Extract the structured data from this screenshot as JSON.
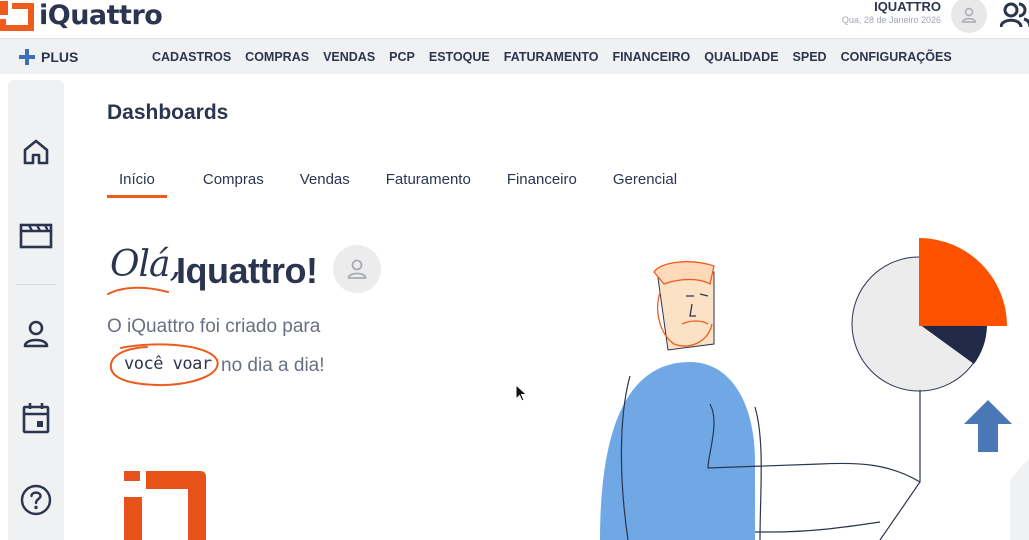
{
  "header": {
    "brand": "iQuattro",
    "user_name": "IQUATTRO",
    "date": "Qua, 28 de Janeiro 2026"
  },
  "nav": {
    "plus_label": "PLUS",
    "items": [
      "CADASTROS",
      "COMPRAS",
      "VENDAS",
      "PCP",
      "ESTOQUE",
      "FATURAMENTO",
      "FINANCEIRO",
      "QUALIDADE",
      "SPED",
      "CONFIGURAÇÕES"
    ]
  },
  "sidebar": {
    "icons": [
      "home-icon",
      "clapperboard-icon",
      "user-icon",
      "calendar-icon",
      "help-icon"
    ]
  },
  "main": {
    "title": "Dashboards",
    "tabs": [
      {
        "label": "Início",
        "active": true
      },
      {
        "label": "Compras",
        "active": false
      },
      {
        "label": "Vendas",
        "active": false
      },
      {
        "label": "Faturamento",
        "active": false
      },
      {
        "label": "Financeiro",
        "active": false
      },
      {
        "label": "Gerencial",
        "active": false
      }
    ],
    "greeting_hello": "Olá,",
    "greeting_name": "Iquattro!",
    "tagline_1": "O iQuattro foi criado para",
    "tagline_highlight": "você voar",
    "tagline_2": "no dia a dia!"
  },
  "colors": {
    "accent": "#ef5a1d",
    "navy": "#2c3550",
    "blue": "#6fa8e4",
    "nav_bg": "#f0f1f2"
  }
}
